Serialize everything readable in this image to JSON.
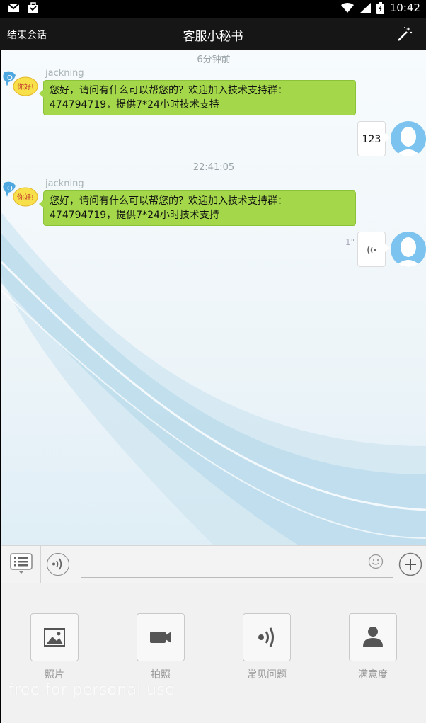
{
  "status_bar": {
    "time": "10:42"
  },
  "title_bar": {
    "end_session_label": "结束会话",
    "title": "客服小秘书"
  },
  "messages": [
    {
      "time_label": "6分钟前",
      "sender": "jackning",
      "text_line1": "您好，请问有什么可以帮您的？欢迎加入技术支持群：",
      "text_line2": "474794719，提供7*24小时技术支持"
    },
    {
      "reply_text": "123"
    },
    {
      "time_label": "22:41:05",
      "sender": "jackning",
      "text_line1": "您好，请问有什么可以帮您的？欢迎加入技术支持群：",
      "text_line2": "474794719，提供7*24小时技术支持"
    },
    {
      "voice_duration": "1\""
    }
  ],
  "bot_avatar_text": "你好!",
  "input": {
    "value": "",
    "placeholder": ""
  },
  "tools": [
    {
      "label": "照片",
      "icon": "image-icon"
    },
    {
      "label": "拍照",
      "icon": "video-camera-icon"
    },
    {
      "label": "常见问题",
      "icon": "voice-wave-icon"
    },
    {
      "label": "满意度",
      "icon": "person-icon"
    }
  ],
  "watermark": "free for personal use",
  "colors": {
    "bubble_in": "#a4d84a",
    "title_bar": "#161616",
    "avatar_user": "#7cc4ef"
  }
}
